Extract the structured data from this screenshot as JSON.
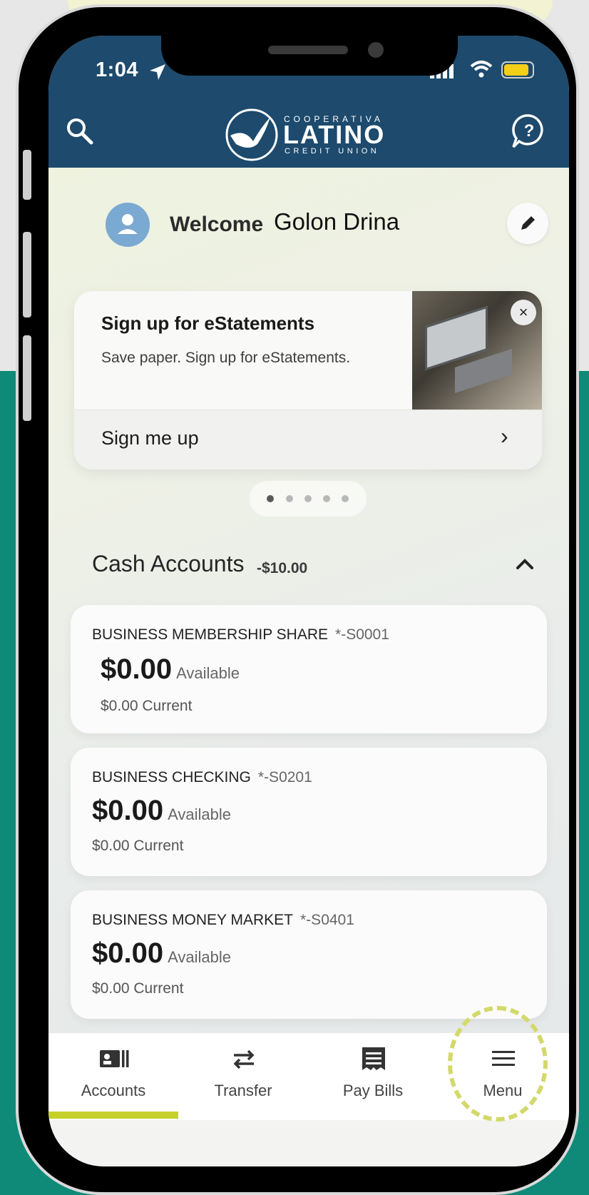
{
  "status_bar": {
    "time": "1:04"
  },
  "header": {
    "logo": {
      "top_text": "COOPERATIVA",
      "main_text": "LATINO",
      "bottom_text": "CREDIT UNION"
    },
    "icons": [
      "search-icon",
      "help-chat-icon"
    ]
  },
  "welcome": {
    "label": "Welcome",
    "name": "Golon Drina"
  },
  "promo": {
    "title": "Sign up for eStatements",
    "description": "Save paper. Sign up for eStatements.",
    "action": "Sign me up",
    "close": "×",
    "chevron": "›",
    "carousel_pages": 5,
    "carousel_active": 1
  },
  "accounts_section": {
    "title": "Cash Accounts",
    "total": "-$10.00",
    "accounts": [
      {
        "name": "BUSINESS MEMBERSHIP SHARE",
        "mask": "*-S0001",
        "available_amount": "$0.00",
        "available_label": "Available",
        "current": "$0.00 Current"
      },
      {
        "name": "BUSINESS CHECKING",
        "mask": "*-S0201",
        "available_amount": "$0.00",
        "available_label": "Available",
        "current": "$0.00 Current"
      },
      {
        "name": "BUSINESS MONEY MARKET",
        "mask": "*-S0401",
        "available_amount": "$0.00",
        "available_label": "Available",
        "current": "$0.00 Current"
      }
    ]
  },
  "tabbar": {
    "tabs": [
      {
        "label": "Accounts",
        "icon": "accounts-card-icon",
        "active": true
      },
      {
        "label": "Transfer",
        "icon": "transfer-arrows-icon",
        "active": false
      },
      {
        "label": "Pay Bills",
        "icon": "receipt-icon",
        "active": false
      },
      {
        "label": "Menu",
        "icon": "hamburger-menu-icon",
        "active": false
      }
    ]
  },
  "colors": {
    "header": "#1d4a6d",
    "accent": "#c5d12a",
    "background_teal": "#0f8a78"
  }
}
